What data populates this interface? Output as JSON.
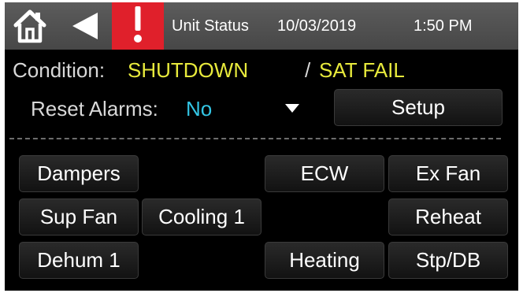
{
  "topbar": {
    "title": "Unit Status",
    "date": "10/03/2019",
    "time": "1:50 PM"
  },
  "status": {
    "condition_label": "Condition:",
    "condition_value": "SHUTDOWN",
    "separator": "/",
    "secondary_value": "SAT FAIL"
  },
  "reset": {
    "label": "Reset Alarms:",
    "value": "No",
    "setup_label": "Setup"
  },
  "buttons": {
    "dampers": "Dampers",
    "ecw": "ECW",
    "ex_fan": "Ex Fan",
    "sup_fan": "Sup Fan",
    "cooling_1": "Cooling 1",
    "reheat": "Reheat",
    "dehum_1": "Dehum 1",
    "heating": "Heating",
    "stp_db": "Stp/DB"
  },
  "colors": {
    "alarm": "#e0202b",
    "value_yellow": "#e8ea3c",
    "value_cyan": "#33c5e4",
    "background": "#000000",
    "topbar": "#525252"
  },
  "icons": {
    "home": "home-icon",
    "back": "back-arrow-icon",
    "alarm": "exclamation-alarm-icon",
    "dropdown": "caret-down-icon"
  }
}
